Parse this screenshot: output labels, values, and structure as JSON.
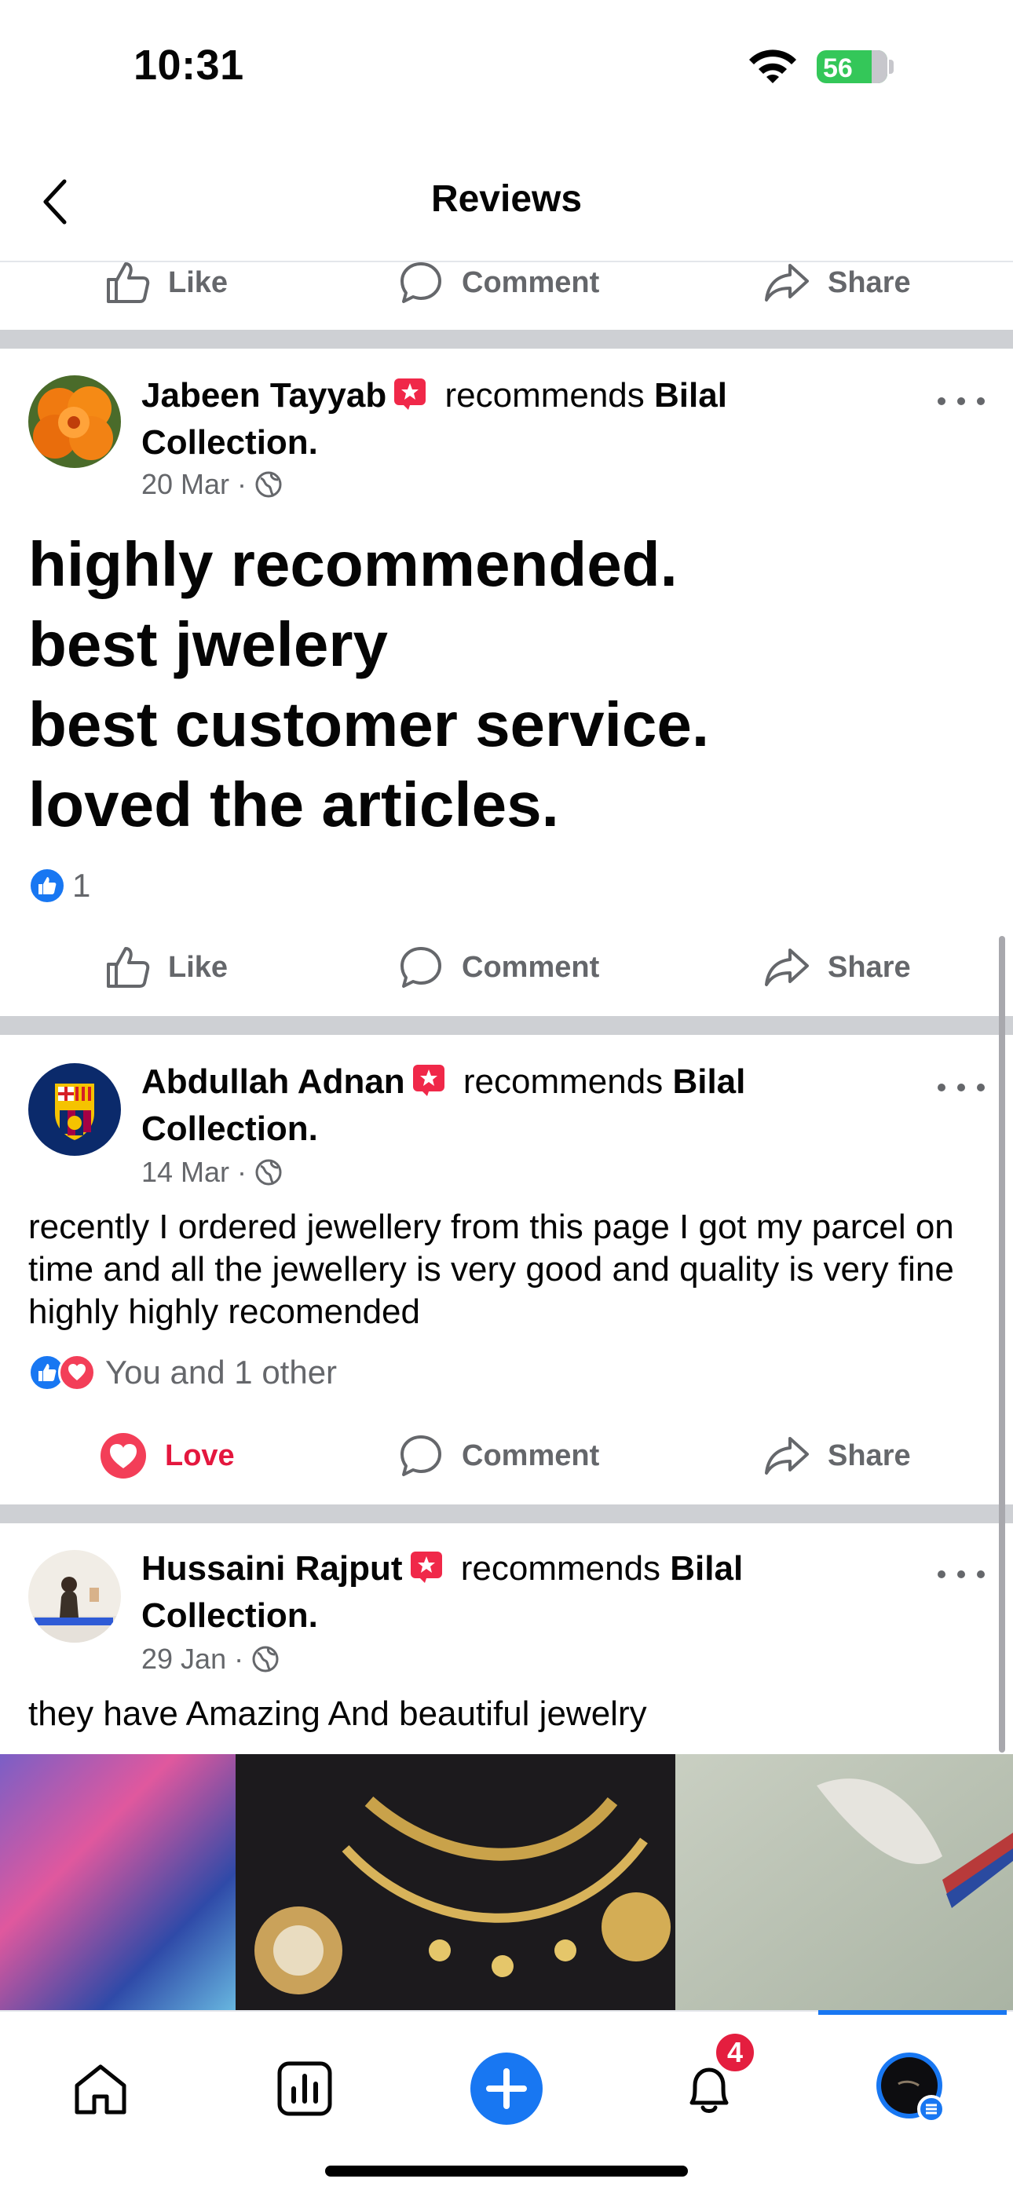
{
  "status_bar": {
    "time": "10:31",
    "battery": "56"
  },
  "header": {
    "title": "Reviews"
  },
  "actions": {
    "like": "Like",
    "comment": "Comment",
    "share": "Share",
    "love": "Love"
  },
  "posts": [
    {
      "author": "Jabeen Tayyab",
      "recommends": "recommends",
      "page": "Bilal",
      "page_rest": "Collection.",
      "date": "20 Mar",
      "text_lines": [
        "highly recommended.",
        "best jwelery",
        "best customer service.",
        "loved the articles."
      ],
      "reaction_count": "1"
    },
    {
      "author": "Abdullah Adnan",
      "recommends": "recommends",
      "page": "Bilal",
      "page_rest": "Collection.",
      "date": "14 Mar",
      "text": "recently I ordered jewellery from this page I got my parcel on time and all the jewellery is very good and quality is very fine highly highly recomended",
      "reaction_summary": "You and 1 other"
    },
    {
      "author": "Hussaini Rajput",
      "recommends": "recommends",
      "page": "Bilal",
      "page_rest": "Collection.",
      "date": "29 Jan",
      "text": "they have Amazing And beautiful jewelry"
    }
  ],
  "tab_bar": {
    "notifications_badge": "4"
  },
  "colors": {
    "accent": "#1877f2",
    "love": "#e4173e",
    "divider": "#ced0d4",
    "muted": "#65676b"
  }
}
